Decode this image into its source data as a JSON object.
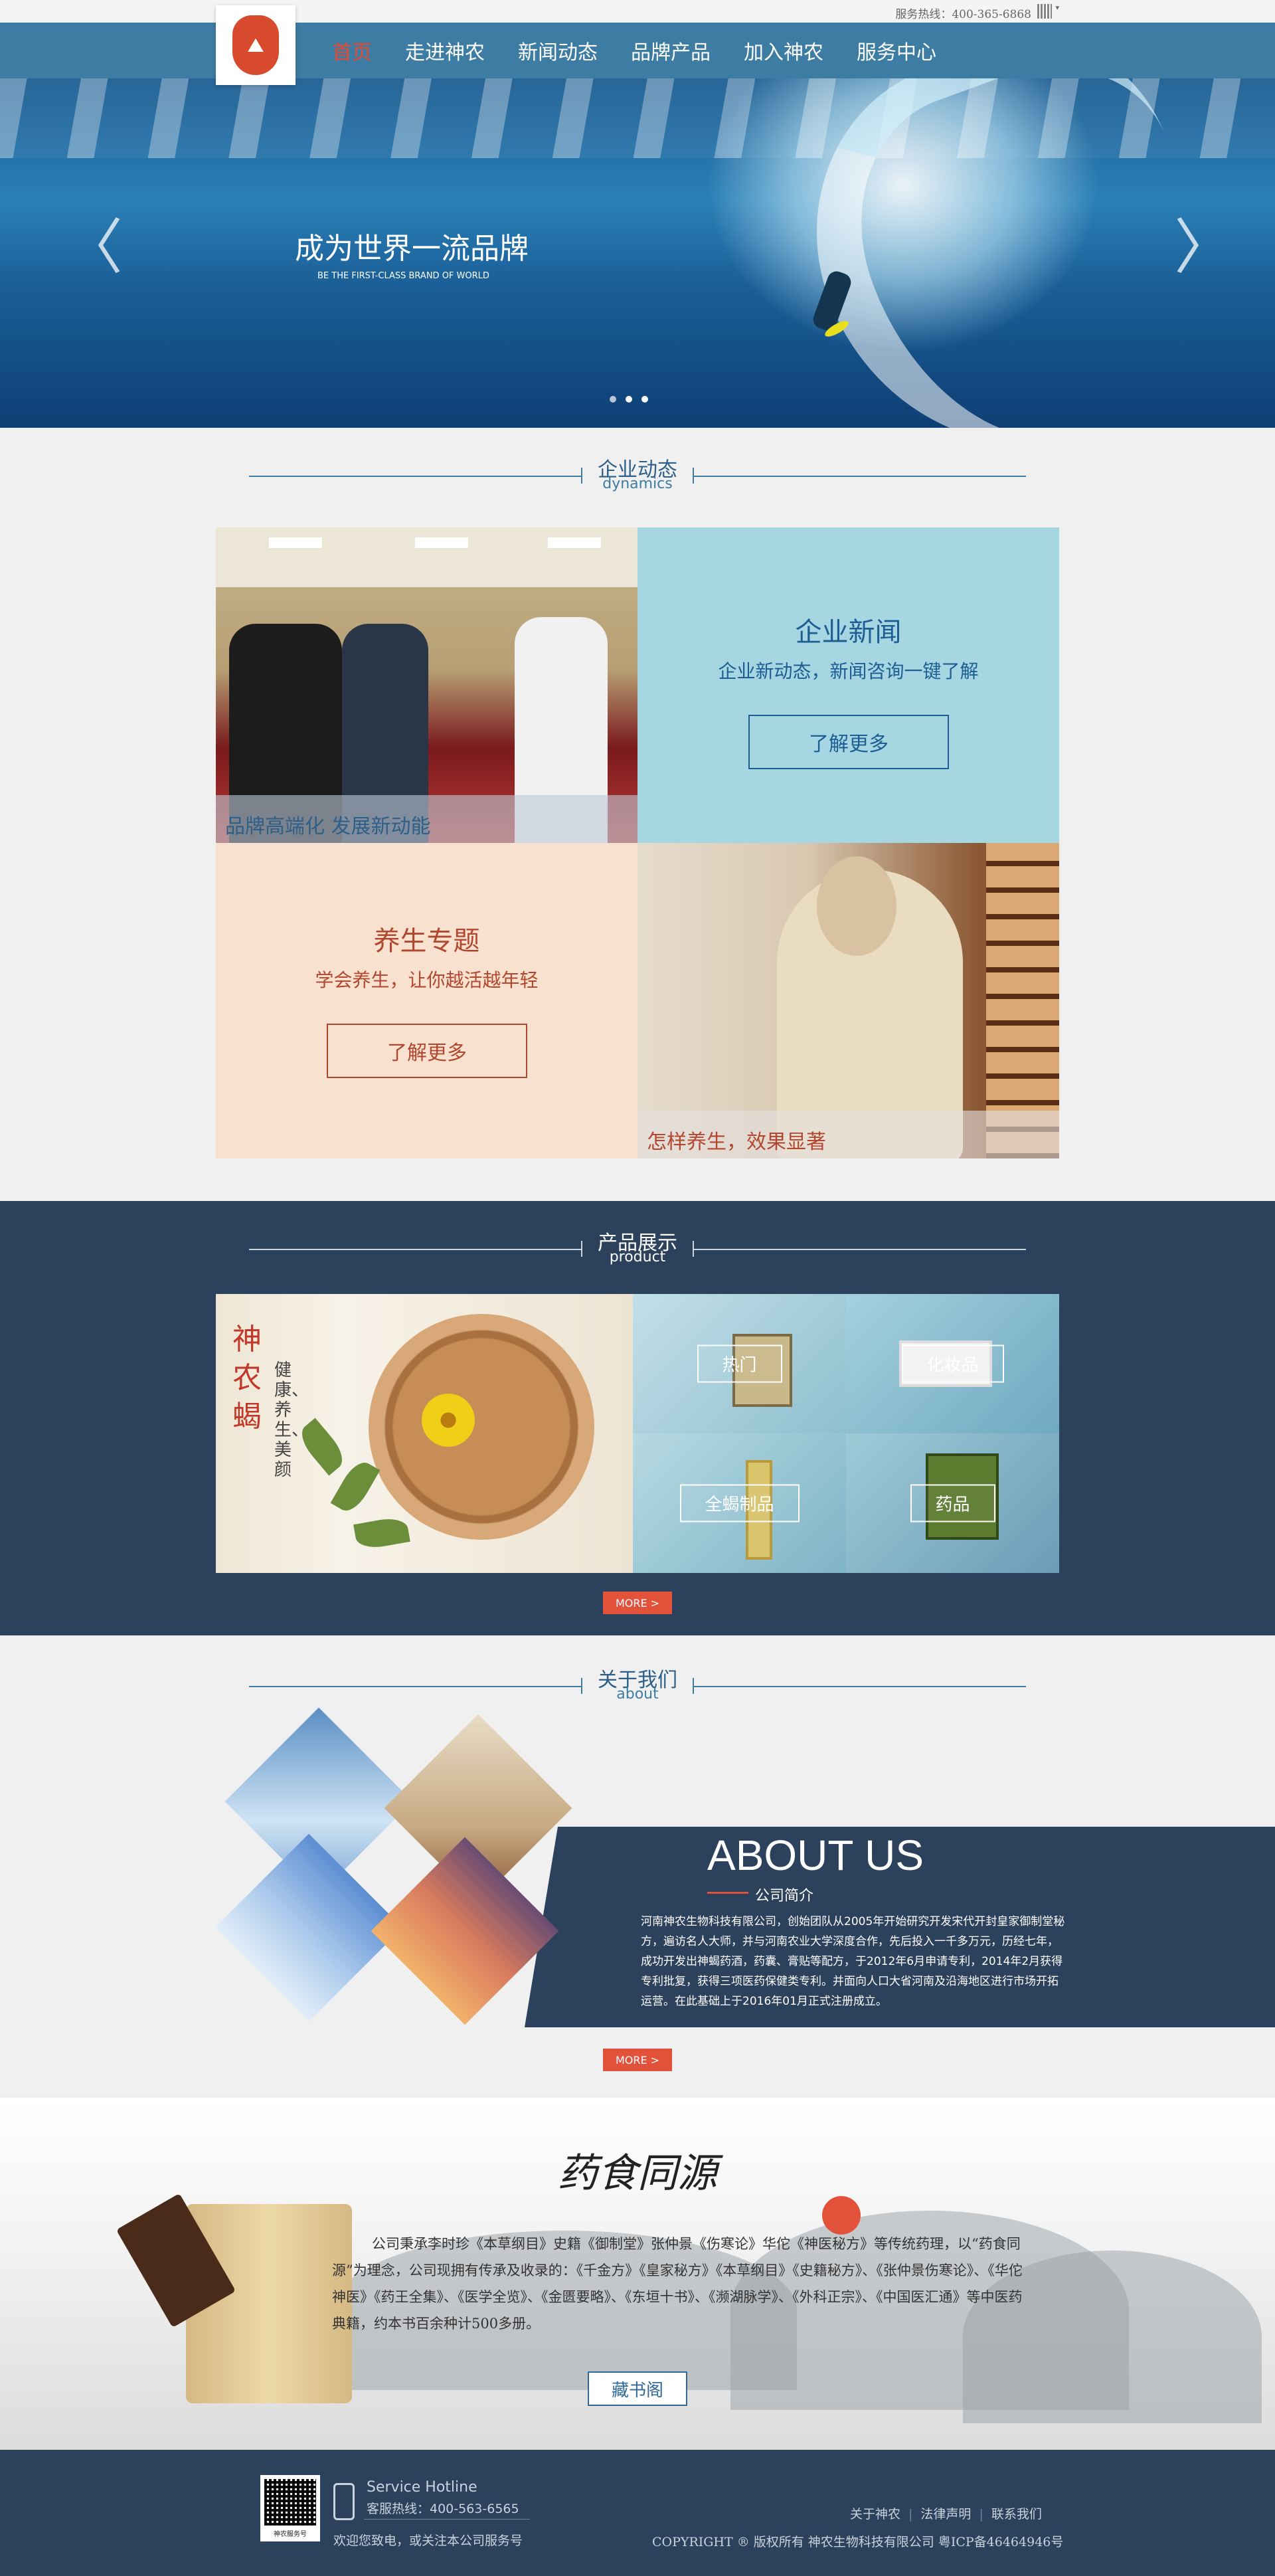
{
  "topbar": {
    "hotline": "服务热线：400-365-6868"
  },
  "nav": {
    "items": [
      "首页",
      "走进神农",
      "新闻动态",
      "品牌产品",
      "加入神农",
      "服务中心"
    ]
  },
  "hero": {
    "title": "成为世界一流品牌",
    "subtitle": "BE THE FIRST-CLASS BRAND OF WORLD"
  },
  "dynamics": {
    "title_cn": "企业动态",
    "title_en": "dynamics",
    "photo1_caption": "品牌高端化 发展新动能",
    "news_title": "企业新闻",
    "news_sub": "企业新动态，新闻咨询一键了解",
    "news_button": "了解更多",
    "health_title": "养生专题",
    "health_sub": "学会养生，让你越活越年轻",
    "health_button": "了解更多",
    "photo2_caption": "怎样养生，效果显著"
  },
  "products": {
    "title_cn": "产品展示",
    "title_en": "product",
    "main_title": "神农蝎",
    "main_sub": "健康、养生、美颜",
    "tiles": [
      "热门",
      "化妆品",
      "全蝎制品",
      "药品"
    ],
    "more": "MORE >"
  },
  "about": {
    "title_cn": "关于我们",
    "title_en": "about",
    "heading": "ABOUT US",
    "caption": "公司简介",
    "body": "河南神农生物科技有限公司，创始团队从2005年开始研究开发宋代开封皇家御制堂秘方，遍访名人大师，并与河南农业大学深度合作，先后投入一千多万元，历经七年，成功开发出神蝎药酒，药囊、膏贴等配方，于2012年6月申请专利，2014年2月获得专利批复，获得三项医药保健类专利。并面向人口大省河南及沿海地区进行市场开拓运营。在此基础上于2016年01月正式注册成立。",
    "more": "MORE >"
  },
  "library": {
    "title": "药食同源",
    "text": "公司秉承李时珍《本草纲目》史籍《御制堂》张仲景《伤寒论》华佗《神医秘方》等传统药理，以“药食同源”为理念，公司现拥有传承及收录的：《千金方》《皇家秘方》《本草纲目》《史籍秘方》、《张仲景伤寒论》、《华佗神医》《药王全集》、《医学全览》、《金匮要略》、《东垣十书》、《濒湖脉学》、《外科正宗》、《中国医汇通》等中医药典籍，约本书百余种计500多册。",
    "button": "藏书阁"
  },
  "footer": {
    "qr_caption": "神农服务号",
    "hotline_en": "Service Hotline",
    "hotline_cn": "客服热线：400-563-6565",
    "welcome": "欢迎您致电，或关注本公司服务号",
    "links": [
      "关于神农",
      "法律声明",
      "联系我们"
    ],
    "copyright": "COPYRIGHT ® 版权所有 神农生物科技有限公司 粤ICP备46464946号"
  },
  "colors": {
    "nav": "#3d7ca3",
    "accent": "#e2513a",
    "dark": "#2c415c"
  },
  "icons": [
    "logo-seal-icon",
    "qr-icon",
    "arrow-left-icon",
    "arrow-right-icon",
    "phone-icon"
  ]
}
